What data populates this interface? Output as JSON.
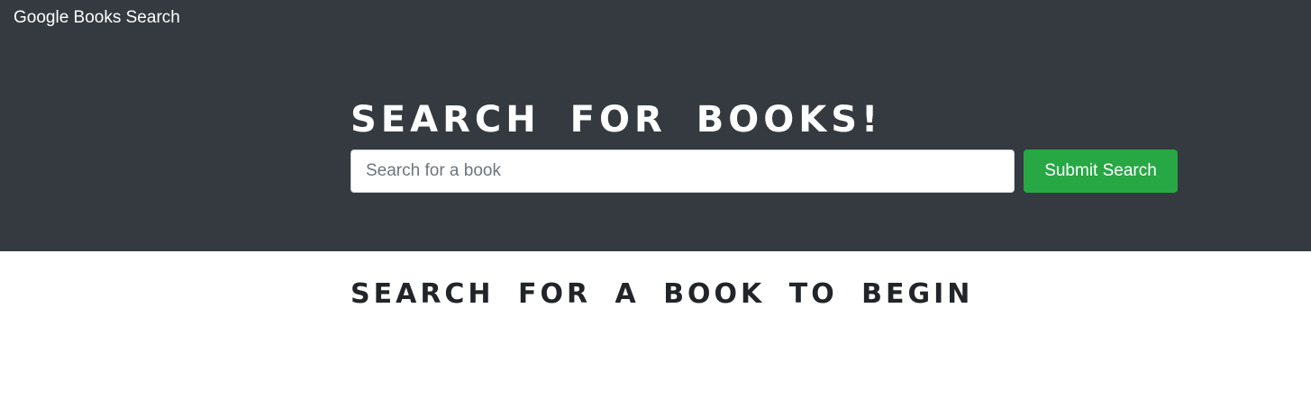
{
  "navbar": {
    "brand": "Google Books Search"
  },
  "hero": {
    "title": "Search for Books!",
    "search": {
      "placeholder": "Search for a book",
      "value": ""
    },
    "submit_label": "Submit Search"
  },
  "results": {
    "heading": "Search for a book to begin"
  },
  "colors": {
    "hero_bg": "#343a40",
    "submit_bg": "#28a745",
    "text_dark": "#212529"
  }
}
